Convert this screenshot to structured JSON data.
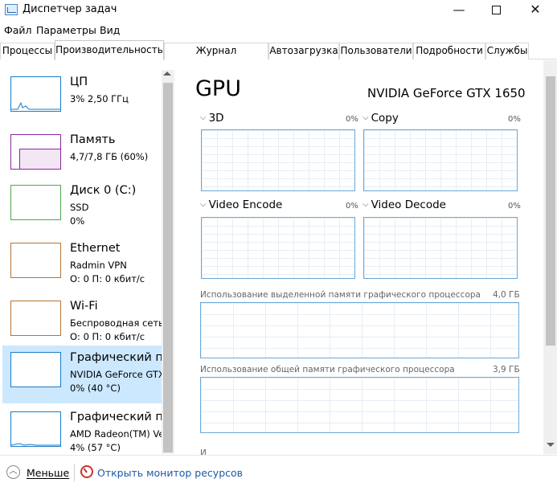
{
  "window": {
    "title": "Диспетчер задач",
    "minimize_glyph": "—",
    "close_glyph": "✕"
  },
  "menu": [
    "Файл",
    "Параметры",
    "Вид"
  ],
  "tabs": [
    {
      "label": "Процессы"
    },
    {
      "label": "Производительность",
      "active": true
    },
    {
      "label": "Журнал приложений"
    },
    {
      "label": "Автозагрузка"
    },
    {
      "label": "Пользователи"
    },
    {
      "label": "Подробности"
    },
    {
      "label": "Службы"
    }
  ],
  "resources": [
    {
      "name": "ЦП",
      "line1": "3%  2,50 ГГц",
      "line2": "",
      "border_color": "#1a7cc7"
    },
    {
      "name": "Память",
      "line1": "4,7/7,8 ГБ (60%)",
      "line2": "",
      "border_color": "#8b27a0",
      "fill_level": 0.6
    },
    {
      "name": "Диск 0 (C:)",
      "line1": "SSD",
      "line2": "0%",
      "border_color": "#4ca84c"
    },
    {
      "name": "Ethernet",
      "line1": "Radmin VPN",
      "line2": "О: 0 П: 0 кбит/с",
      "border_color": "#b87333"
    },
    {
      "name": "Wi-Fi",
      "line1": "Беспроводная сеть",
      "line2": "О: 0 П: 0 кбит/с",
      "border_color": "#b87333"
    },
    {
      "name": "Графический п",
      "line1": "NVIDIA GeForce GTX",
      "line2": "0% (40 °C)",
      "border_color": "#1a7cc7",
      "selected": true
    },
    {
      "name": "Графический п",
      "line1": "AMD Radeon(TM) Ve",
      "line2": "4% (57 °C)",
      "border_color": "#1a7cc7"
    }
  ],
  "detail": {
    "title": "GPU",
    "model": "NVIDIA GeForce GTX 1650",
    "engines": [
      {
        "label": "3D",
        "value": "0%"
      },
      {
        "label": "Copy",
        "value": "0%"
      },
      {
        "label": "Video Encode",
        "value": "0%"
      },
      {
        "label": "Video Decode",
        "value": "0%"
      }
    ],
    "memory": [
      {
        "label": "Использование выделенной памяти графического процессора",
        "value": "4,0 ГБ"
      },
      {
        "label": "Использование общей памяти графического процессора",
        "value": "3,9 ГБ"
      }
    ],
    "cut_label": "И"
  },
  "footer": {
    "collapse_label": "Меньше",
    "monitor_link": "Открыть монитор ресурсов"
  },
  "colors": {
    "selected_bg": "#cce8ff",
    "graph_border": "#6aa8d8",
    "link": "#1a5aa8"
  }
}
